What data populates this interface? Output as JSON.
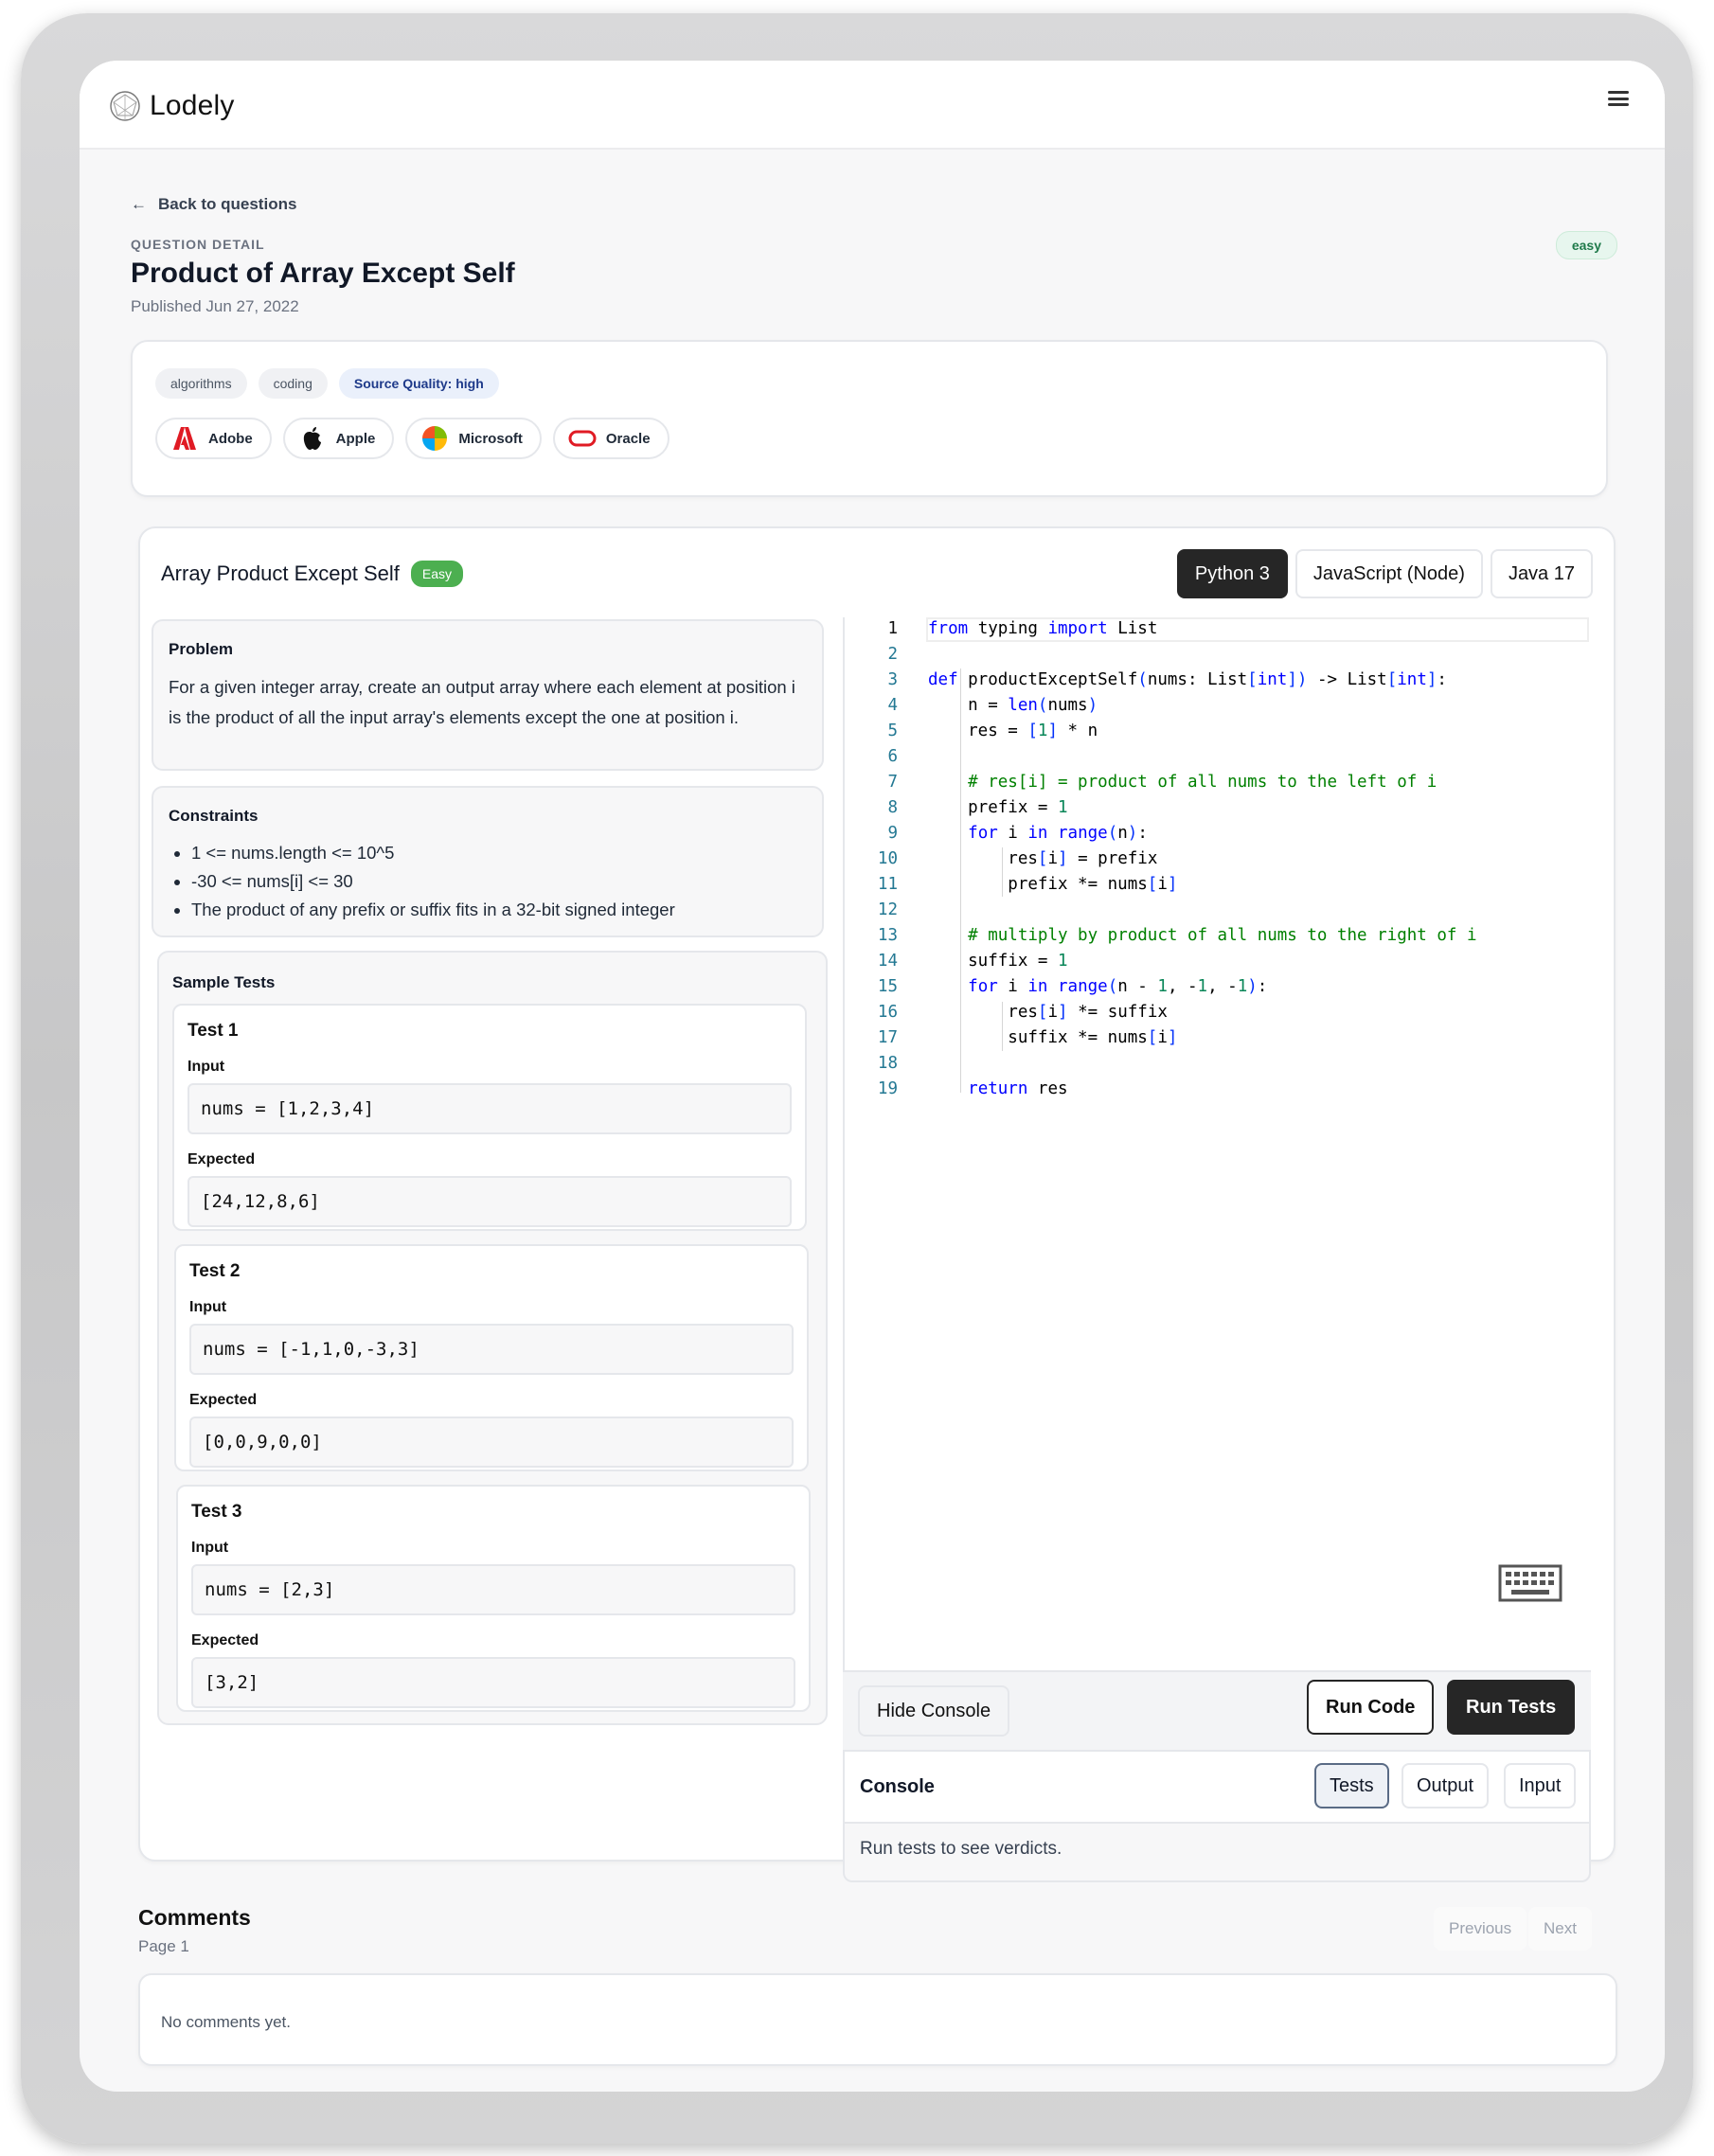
{
  "app": {
    "name": "Lodely"
  },
  "nav": {
    "back_label": "Back to questions"
  },
  "question": {
    "eyebrow": "QUESTION DETAIL",
    "title": "Product of Array Except Self",
    "published": "Published Jun 27, 2022",
    "difficulty": "easy"
  },
  "tags": [
    "algorithms",
    "coding",
    "Source Quality: high"
  ],
  "companies": [
    "Adobe",
    "Apple",
    "Microsoft",
    "Oracle"
  ],
  "problem": {
    "name": "Array Product Except Self",
    "badge": "Easy",
    "section_title": "Problem",
    "description": "For a given integer array, create an output array where each element at position i is the product of all the input array's elements except the one at position i."
  },
  "constraints": {
    "title": "Constraints",
    "items": [
      "1 <= nums.length <= 10^5",
      "-30 <= nums[i] <= 30",
      "The product of any prefix or suffix fits in a 32-bit signed integer"
    ]
  },
  "sample_tests": {
    "title": "Sample Tests",
    "input_label": "Input",
    "expected_label": "Expected",
    "tests": [
      {
        "name": "Test 1",
        "input": "nums = [1,2,3,4]",
        "expected": "[24,12,8,6]"
      },
      {
        "name": "Test 2",
        "input": "nums = [-1,1,0,-3,3]",
        "expected": "[0,0,9,0,0]"
      },
      {
        "name": "Test 3",
        "input": "nums = [2,3]",
        "expected": "[3,2]"
      }
    ]
  },
  "languages": [
    "Python 3",
    "JavaScript (Node)",
    "Java 17"
  ],
  "active_language": "Python 3",
  "code_lines": [
    "from typing import List",
    "",
    "def productExceptSelf(nums: List[int]) -> List[int]:",
    "    n = len(nums)",
    "    res = [1] * n",
    "",
    "    # res[i] = product of all nums to the left of i",
    "    prefix = 1",
    "    for i in range(n):",
    "        res[i] = prefix",
    "        prefix *= nums[i]",
    "",
    "    # multiply by product of all nums to the right of i",
    "    suffix = 1",
    "    for i in range(n - 1, -1, -1):",
    "        res[i] *= suffix",
    "        suffix *= nums[i]",
    "",
    "    return res"
  ],
  "actions": {
    "hide_console": "Hide Console",
    "run_code": "Run Code",
    "run_tests": "Run Tests"
  },
  "console": {
    "title": "Console",
    "tabs": [
      "Tests",
      "Output",
      "Input"
    ],
    "active_tab": "Tests",
    "message": "Run tests to see verdicts."
  },
  "comments": {
    "title": "Comments",
    "page": "Page 1",
    "previous": "Previous",
    "next": "Next",
    "empty": "No comments yet."
  },
  "colors": {
    "keyword": "#0000ff",
    "comment": "#008000",
    "number": "#098658",
    "line_number": "#237893",
    "dark_button": "#262626",
    "easy_badge": "#4caf50"
  }
}
